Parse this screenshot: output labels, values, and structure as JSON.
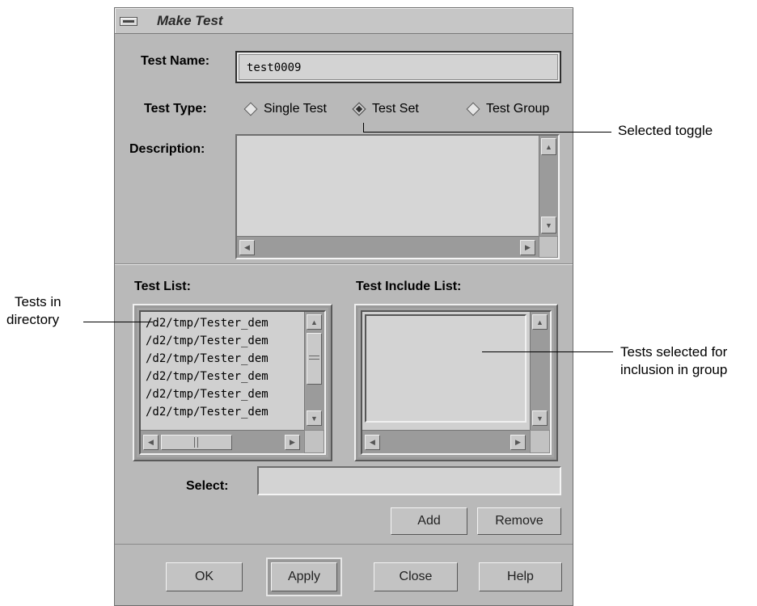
{
  "window": {
    "title": "Make Test"
  },
  "form": {
    "test_name_label": "Test Name:",
    "test_name_value": "test0009",
    "test_type_label": "Test Type:",
    "test_types": [
      {
        "label": "Single Test",
        "selected": false
      },
      {
        "label": "Test Set",
        "selected": true
      },
      {
        "label": "Test Group",
        "selected": false
      }
    ],
    "description_label": "Description:",
    "description_value": ""
  },
  "test_list": {
    "label": "Test List:",
    "items": [
      "/d2/tmp/Tester_dem",
      "/d2/tmp/Tester_dem",
      "/d2/tmp/Tester_dem",
      "/d2/tmp/Tester_dem",
      "/d2/tmp/Tester_dem",
      "/d2/tmp/Tester_dem"
    ]
  },
  "include_list": {
    "label": "Test Include List:",
    "items": []
  },
  "select": {
    "label": "Select:",
    "value": ""
  },
  "list_buttons": {
    "add": "Add",
    "remove": "Remove"
  },
  "dialog_buttons": {
    "ok": "OK",
    "apply": "Apply",
    "close": "Close",
    "help": "Help"
  },
  "callouts": {
    "selected_toggle": "Selected toggle",
    "tests_in_directory_1": "Tests in",
    "tests_in_directory_2": "directory",
    "tests_selected_1": "Tests selected for",
    "tests_selected_2": "inclusion in group"
  },
  "colors": {
    "window_bg": "#b9b9b9",
    "field_bg": "#d3d3d3",
    "selected_toggle": "#2e2e2e"
  }
}
